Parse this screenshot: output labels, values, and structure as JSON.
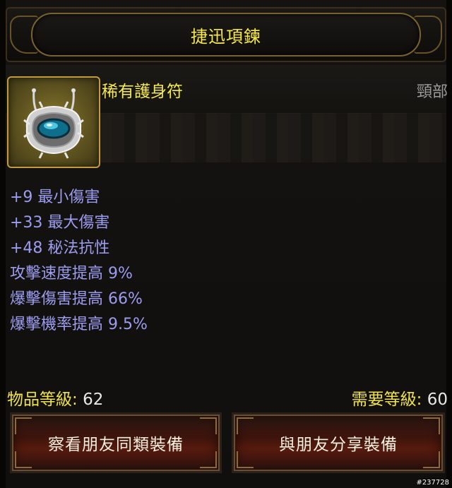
{
  "title": "捷迅項鍊",
  "item": {
    "rarity_type": "稀有護身符",
    "slot": "頸部",
    "icon": "amulet-icon"
  },
  "stats": [
    "+9 最小傷害",
    "+33 最大傷害",
    "+48 秘法抗性",
    "攻擊速度提高 9%",
    "爆擊傷害提高 66%",
    "爆擊機率提高 9.5%"
  ],
  "levels": {
    "item_label": "物品等級:",
    "item_value": "62",
    "required_label": "需要等級:",
    "required_value": "60"
  },
  "buttons": {
    "compare": "察看朋友同類裝備",
    "share": "與朋友分享裝備"
  },
  "watermark": "#237728",
  "colors": {
    "title": "#f7e84a",
    "stat": "#9c9cf0",
    "slot": "#9b9b9b"
  }
}
